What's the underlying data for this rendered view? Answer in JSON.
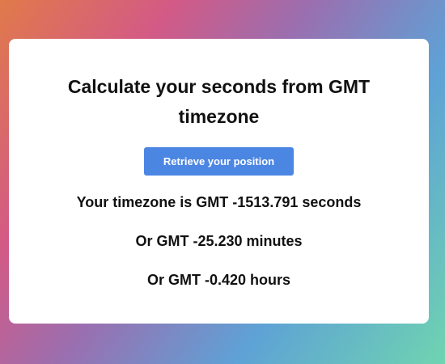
{
  "card": {
    "title": "Calculate your seconds from GMT timezone",
    "button_label": "Retrieve your position",
    "results": {
      "seconds": "Your timezone is GMT -1513.791 seconds",
      "minutes": "Or GMT -25.230 minutes",
      "hours": "Or GMT -0.420 hours"
    }
  }
}
